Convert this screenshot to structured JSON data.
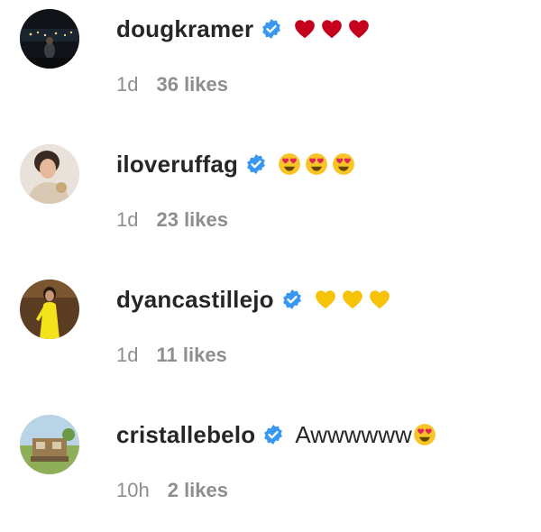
{
  "colors": {
    "text": "#262626",
    "secondary": "#8e8e8e",
    "verified_blue": "#3897f0",
    "heart_red": "#c4001c",
    "heart_yellow": "#f7c30a",
    "emoji_face": "#f8c426"
  },
  "comments": [
    {
      "username": "dougkramer",
      "verified": true,
      "emojis": [
        "red-heart-icon",
        "red-heart-icon",
        "red-heart-icon"
      ],
      "text": "",
      "time": "1d",
      "likes": "36 likes"
    },
    {
      "username": "iloveruffag",
      "verified": true,
      "emojis": [
        "heart-eyes-emoji-icon",
        "heart-eyes-emoji-icon",
        "heart-eyes-emoji-icon"
      ],
      "text": "",
      "time": "1d",
      "likes": "23 likes"
    },
    {
      "username": "dyancastillejo",
      "verified": true,
      "emojis": [
        "yellow-heart-icon",
        "yellow-heart-icon",
        "yellow-heart-icon"
      ],
      "text": "",
      "time": "1d",
      "likes": "11 likes"
    },
    {
      "username": "cristallebelo",
      "verified": true,
      "emojis": [
        "heart-eyes-emoji-icon"
      ],
      "text": "Awwwwww",
      "time": "10h",
      "likes": "2 likes"
    }
  ]
}
